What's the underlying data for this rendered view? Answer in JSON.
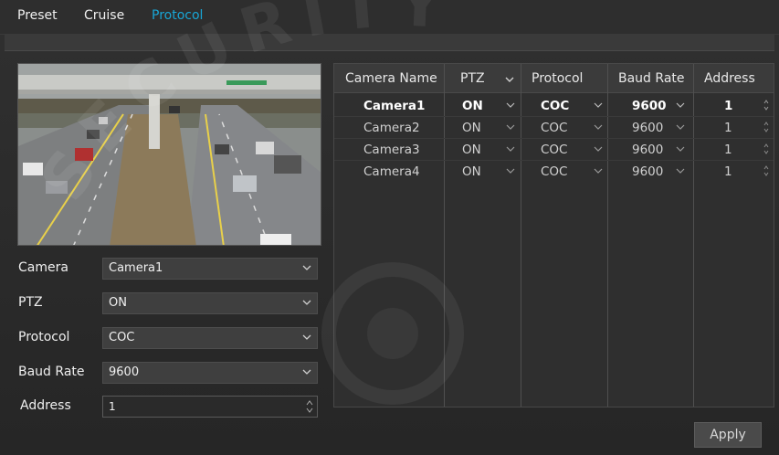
{
  "tabs": [
    {
      "label": "Preset"
    },
    {
      "label": "Cruise"
    },
    {
      "label": "Protocol"
    }
  ],
  "form": {
    "camera_label": "Camera",
    "camera_value": "Camera1",
    "ptz_label": "PTZ",
    "ptz_value": "ON",
    "protocol_label": "Protocol",
    "protocol_value": "COC",
    "baud_label": "Baud Rate",
    "baud_value": "9600",
    "address_label": "Address",
    "address_value": "1"
  },
  "table": {
    "headers": [
      "Camera Name",
      "PTZ",
      "Protocol",
      "Baud Rate",
      "Address"
    ],
    "rows": [
      {
        "name": "Camera1",
        "ptz": "ON",
        "protocol": "COC",
        "baud": "9600",
        "address": "1"
      },
      {
        "name": "Camera2",
        "ptz": "ON",
        "protocol": "COC",
        "baud": "9600",
        "address": "1"
      },
      {
        "name": "Camera3",
        "ptz": "ON",
        "protocol": "COC",
        "baud": "9600",
        "address": "1"
      },
      {
        "name": "Camera4",
        "ptz": "ON",
        "protocol": "COC",
        "baud": "9600",
        "address": "1"
      }
    ]
  },
  "apply_label": "Apply",
  "watermark_text": "SECURITY",
  "colors": {
    "accent": "#18a6d6",
    "background": "#2b2b2b",
    "panel": "#3f3f3f"
  }
}
